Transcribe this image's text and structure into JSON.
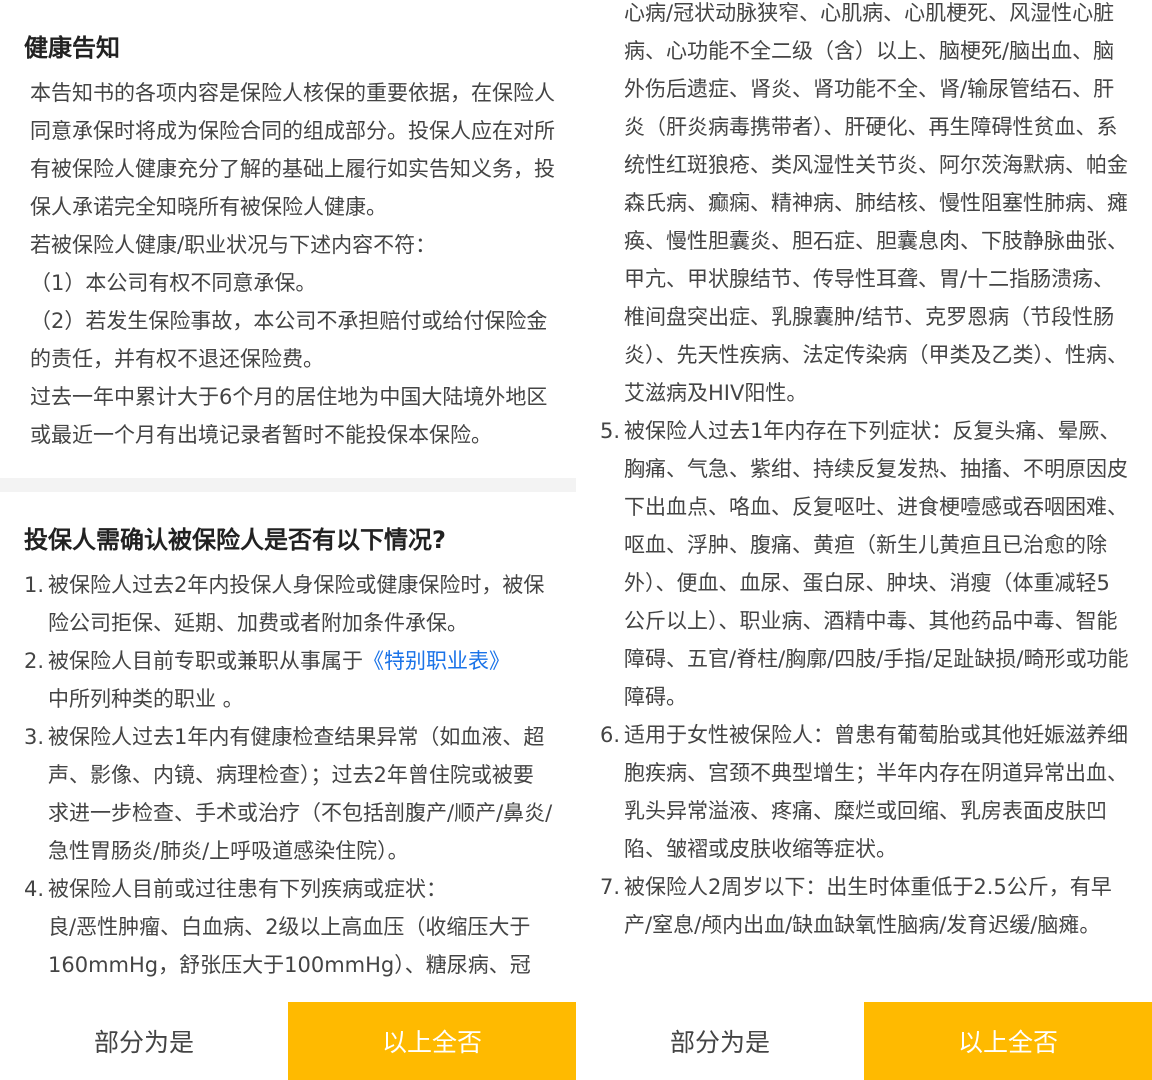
{
  "health_notice": {
    "title": "健康告知",
    "paragraphs": [
      "本告知书的各项内容是保险人核保的重要依据，在保险人同意承保时将成为保险合同的组成部分。投保人应在对所有被保险人健康充分了解的基础上履行如实告知义务，投保人承诺完全知晓所有被保险人健康。",
      "若被保险人健康/职业状况与下述内容不符：",
      "（1）本公司有权不同意承保。",
      "（2）若发生保险事故，本公司不承担赔付或给付保险金的责任，并有权不退还保险费。",
      "过去一年中累计大于6个月的居住地为中国大陆境外地区或最近一个月有出境记录者暂时不能投保本保险。"
    ]
  },
  "questions": {
    "title": "投保人需确认被保险人是否有以下情况?",
    "items": [
      {
        "num": "1.",
        "text": "被保险人过去2年内投保人身保险或健康保险时，被保险公司拒保、延期、加费或者附加条件承保。"
      },
      {
        "num": "2.",
        "text_before": "被保险人目前专职或兼职从事属于",
        "link": "《特别职业表》",
        "text_after": "中所列种类的职业 。"
      },
      {
        "num": "3.",
        "text": "被保险人过去1年内有健康检查结果异常（如血液、超声、影像、内镜、病理检查）；过去2年曾住院或被要求进一步检查、手术或治疗（不包括剖腹产/顺产/鼻炎/急性胃肠炎/肺炎/上呼吸道感染住院）。"
      },
      {
        "num": "4.",
        "intro": "被保险人目前或过往患有下列疾病或症状：",
        "text": "良/恶性肿瘤、白血病、2级以上高血压（收缩压大于160mmHg，舒张压大于100mmHg）、糖尿病、冠心病/冠状动脉狭窄、心肌病、心肌梗死、风湿性心脏病、心功能不全二级（含）以上、脑梗死/脑出血、脑外伤后遗症、肾炎、肾功能不全、肾/输尿管结石、肝炎（肝炎病毒携带者）、肝硬化、再生障碍性贫血、系统性红斑狼疮、类风湿性关节炎、阿尔茨海默病、帕金森氏病、癫痫、精神病、肺结核、慢性阻塞性肺病、瘫痪、慢性胆囊炎、胆石症、胆囊息肉、下肢静脉曲张、甲亢、甲状腺结节、传导性耳聋、胃/十二指肠溃疡、椎间盘突出症、乳腺囊肿/结节、克罗恩病（节段性肠炎）、先天性疾病、法定传染病（甲类及乙类）、性病、艾滋病及HIV阳性。"
      },
      {
        "num": "5.",
        "text": "被保险人过去1年内存在下列症状：反复头痛、晕厥、胸痛、气急、紫绀、持续反复发热、抽搐、不明原因皮下出血点、咯血、反复呕吐、进食梗噎感或吞咽困难、呕血、浮肿、腹痛、黄疸（新生儿黄疸且已治愈的除外）、便血、血尿、蛋白尿、肿块、消瘦（体重减轻5公斤以上）、职业病、酒精中毒、其他药品中毒、智能障碍、五官/脊柱/胸廓/四肢/手指/足趾缺损/畸形或功能障碍。"
      },
      {
        "num": "6.",
        "text": "适用于女性被保险人：曾患有葡萄胎或其他妊娠滋养细胞疾病、宫颈不典型增生；半年内存在阴道异常出血、乳头异常溢液、疼痛、糜烂或回缩、乳房表面皮肤凹陷、皱褶或皮肤收缩等症状。"
      },
      {
        "num": "7.",
        "text": "被保险人2周岁以下：出生时体重低于2.5公斤，有早产/窒息/颅内出血/缺血缺氧性脑病/发育迟缓/脑瘫。"
      }
    ]
  },
  "right_item4_tail": "心病/冠状动脉狭窄、心肌病、心肌梗死、风湿性心脏病、心功能不全二级（含）以上、脑梗死/脑出血、脑外伤后遗症、肾炎、肾功能不全、肾/输尿管结石、肝炎（肝炎病毒携带者）、肝硬化、再生障碍性贫血、系统性红斑狼疮、类风湿性关节炎、阿尔茨海默病、帕金森氏病、癫痫、精神病、肺结核、慢性阻塞性肺病、瘫痪、慢性胆囊炎、胆石症、胆囊息肉、下肢静脉曲张、甲亢、甲状腺结节、传导性耳聋、胃/十二指肠溃疡、椎间盘突出症、乳腺囊肿/结节、克罗恩病（节段性肠炎）、先天性疾病、法定传染病（甲类及乙类）、性病、艾滋病及HIV阳性。",
  "left_item4_head": "良/恶性肿瘤、白血病、2级以上高血压（收缩压大于160mmHg，舒张压大于100mmHg）、糖尿病、冠",
  "footer": {
    "partial_label": "部分为是",
    "none_label": "以上全否"
  },
  "colors": {
    "accent": "#ffba00",
    "link": "#1a73e8"
  }
}
